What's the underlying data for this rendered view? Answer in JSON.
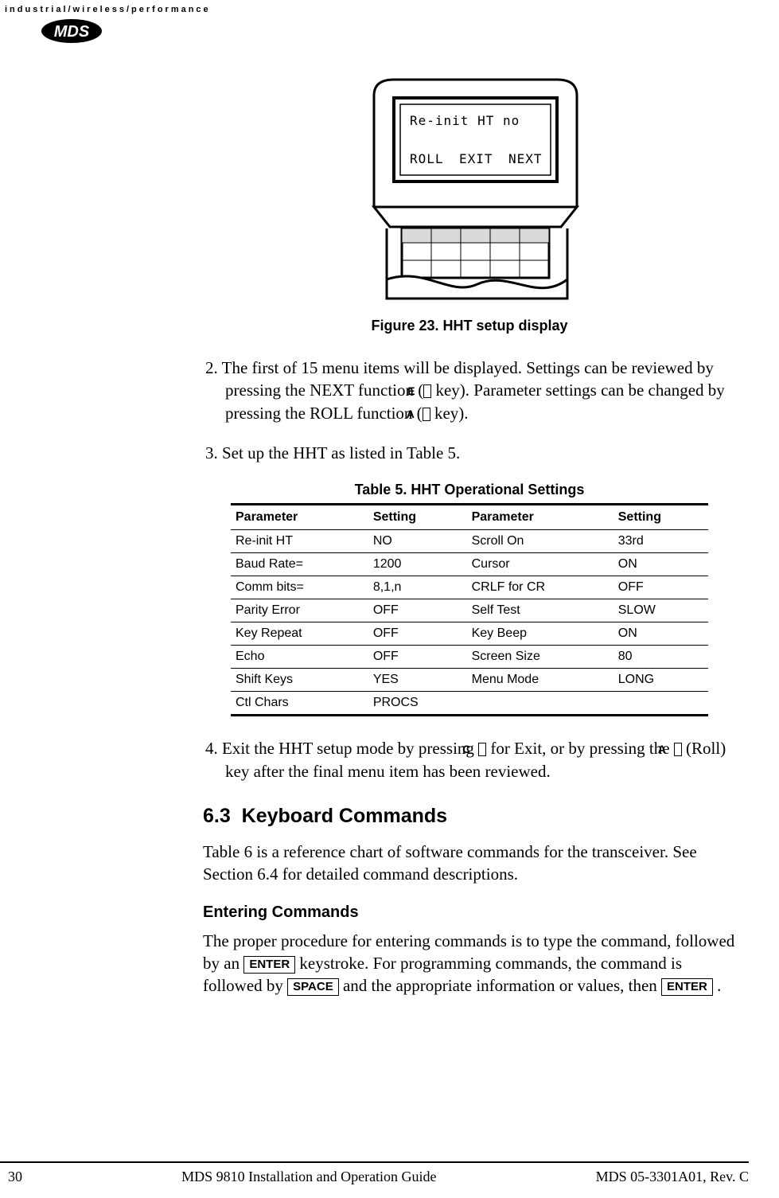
{
  "header": {
    "tagline": "industrial/wireless/performance",
    "logo_text": "MDS"
  },
  "figure": {
    "screen_line1": "Re-init HT   no",
    "screen_btn1": "ROLL",
    "screen_btn2": "EXIT",
    "screen_btn3": "NEXT",
    "caption": "Figure 23. HHT setup display"
  },
  "steps": {
    "s2_num": "2. ",
    "s2a": "The first of 15 menu items will be displayed. Settings can be reviewed by pressing the NEXT function (",
    "key_e": "E",
    "s2b": " key). Parameter settings can be changed by pressing the ROLL function (",
    "key_a": "A",
    "s2c": " key).",
    "s3_num": "3. ",
    "s3": "Set up the HHT as listed in Table 5.",
    "s4_num": "4. ",
    "s4a": "Exit the HHT setup mode by pressing ",
    "key_c": "C",
    "s4b": " for Exit, or by pressing the ",
    "key_a2": "A",
    "s4c": " (Roll) key after the final menu item has been reviewed."
  },
  "table": {
    "caption": "Table 5. HHT Operational Settings",
    "headers": {
      "p1": "Parameter",
      "s1": "Setting",
      "p2": "Parameter",
      "s2": "Setting"
    },
    "rows": [
      {
        "p1": "Re-init HT",
        "s1": "NO",
        "p2": "Scroll On",
        "s2": "33rd"
      },
      {
        "p1": "Baud Rate=",
        "s1": "1200",
        "p2": "Cursor",
        "s2": "ON"
      },
      {
        "p1": "Comm bits=",
        "s1": "8,1,n",
        "p2": "CRLF for CR",
        "s2": "OFF"
      },
      {
        "p1": "Parity Error",
        "s1": "OFF",
        "p2": "Self Test",
        "s2": "SLOW"
      },
      {
        "p1": "Key Repeat",
        "s1": "OFF",
        "p2": "Key Beep",
        "s2": "ON"
      },
      {
        "p1": "Echo",
        "s1": "OFF",
        "p2": "Screen Size",
        "s2": "80"
      },
      {
        "p1": "Shift Keys",
        "s1": "YES",
        "p2": "Menu Mode",
        "s2": "LONG"
      },
      {
        "p1": "Ctl Chars",
        "s1": "PROCS",
        "p2": "",
        "s2": ""
      }
    ]
  },
  "section": {
    "num": "6.3",
    "title": "Keyboard Commands",
    "intro": "Table 6 is a reference chart of software commands for the transceiver. See Section 6.4 for detailed command descriptions."
  },
  "subsection": {
    "title": "Entering Commands",
    "p1": "The proper procedure for entering commands is to type the command, followed by an ",
    "key_enter": "ENTER",
    "p2": " keystroke. For programming commands, the command is followed by ",
    "key_space": "SPACE",
    "p3": " and the appropriate information or values, then ",
    "key_enter2": "ENTER",
    "p4": " ."
  },
  "footer": {
    "page": "30",
    "center": "MDS 9810 Installation and Operation Guide",
    "right": "MDS 05-3301A01, Rev. C"
  }
}
